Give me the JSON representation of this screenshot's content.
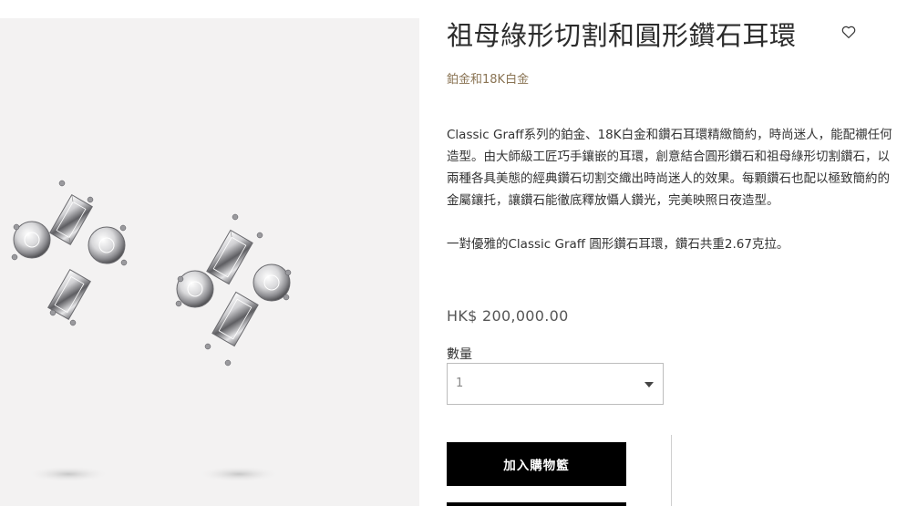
{
  "product": {
    "title": "祖母綠形切割和圓形鑽石耳環",
    "material": "鉑金和18K白金",
    "description_1": "Classic Graff系列的鉑金、18K白金和鑽石耳環精緻簡約，時尚迷人，能配襯任何造型。由大師級工匠巧手鑲嵌的耳環，創意結合圓形鑽石和祖母綠形切割鑽石，以兩種各具美態的經典鑽石切割交織出時尚迷人的效果。每顆鑽石也配以極致簡約的金屬鑲托，讓鑽石能徹底釋放懾人鑽光，完美映照日夜造型。",
    "description_2": "一對優雅的Classic Graff 圓形鑽石耳環，鑽石共重2.67克拉。",
    "price": "HK$ 200,000.00"
  },
  "quantity": {
    "label": "數量",
    "selected": "1"
  },
  "actions": {
    "add_to_bag": "加入購物籃"
  },
  "icons": {
    "wishlist": "heart-outline-icon",
    "dropdown": "chevron-down-icon"
  },
  "colors": {
    "accent_gold": "#8a7454",
    "button_bg": "#000000",
    "image_bg": "#f3f2f2"
  }
}
